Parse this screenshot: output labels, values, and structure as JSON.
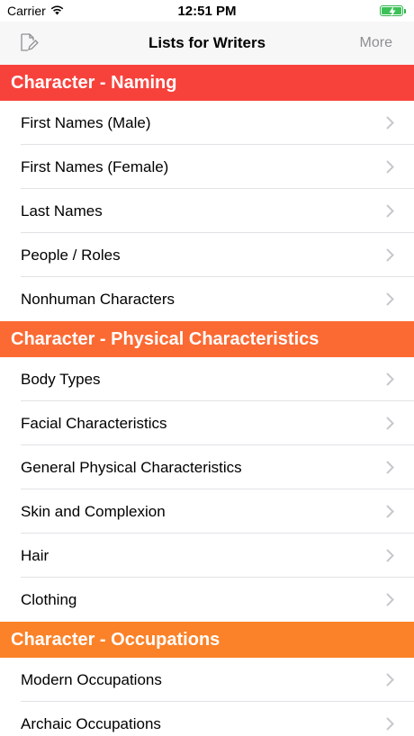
{
  "status_bar": {
    "carrier": "Carrier",
    "time": "12:51 PM",
    "battery_level": 1.0
  },
  "nav": {
    "title": "Lists for Writers",
    "more_label": "More",
    "edit_icon": "compose-icon"
  },
  "colors": {
    "naming": "#f7423b",
    "physical": "#fb6a33",
    "occupations": "#fb8228",
    "chevron": "#c7c7cc",
    "battery": "#3cc157"
  },
  "sections": [
    {
      "title": "Character - Naming",
      "items": [
        "First Names (Male)",
        "First Names (Female)",
        "Last Names",
        "People / Roles",
        "Nonhuman Characters"
      ]
    },
    {
      "title": "Character - Physical Characteristics",
      "items": [
        "Body Types",
        "Facial Characteristics",
        "General Physical Characteristics",
        "Skin and Complexion",
        "Hair",
        "Clothing"
      ]
    },
    {
      "title": "Character - Occupations",
      "items": [
        "Modern Occupations",
        "Archaic Occupations"
      ]
    }
  ]
}
